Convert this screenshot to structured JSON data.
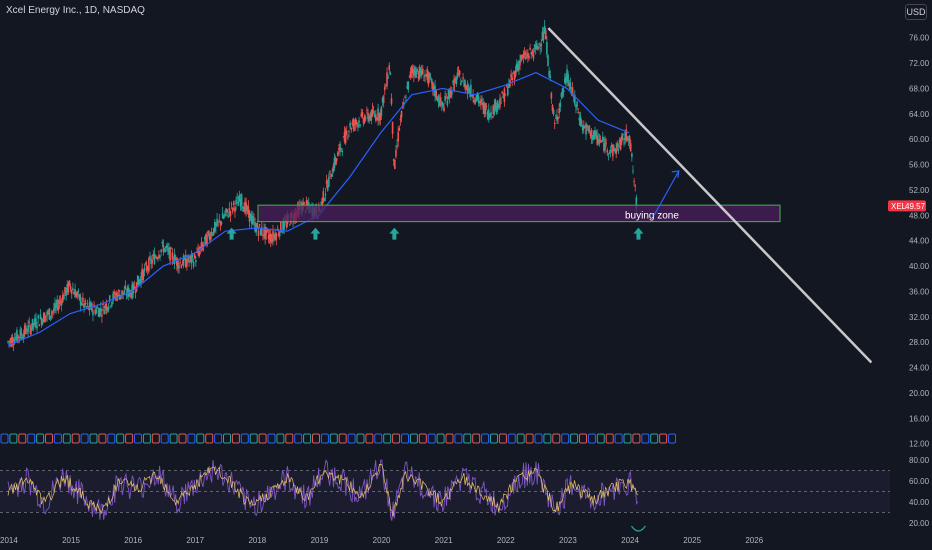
{
  "header": {
    "title": "Xcel Energy Inc., 1D, NASDAQ",
    "currency": "USD"
  },
  "colors": {
    "background": "#131722",
    "up": "#26a69a",
    "down": "#ef5350",
    "ma": "#2962ff",
    "zone_fill": "#4a1f5c",
    "zone_border": "#4caf50",
    "trendline": "#c8c8c8",
    "arrow": "#26a69a",
    "rsi": "#7e57c2",
    "rsi_signal": "#e9c46a",
    "price_tag": "#f23645"
  },
  "chart_data": [
    {
      "type": "line",
      "title": "Xcel Energy Inc., 1D, NASDAQ",
      "xlabel": "",
      "ylabel": "",
      "x_ticks": [
        "2014",
        "2015",
        "2016",
        "2017",
        "2018",
        "2019",
        "2020",
        "2021",
        "2022",
        "2023",
        "2024",
        "2025",
        "2026"
      ],
      "y_ticks": [
        "76.00",
        "72.00",
        "68.00",
        "64.00",
        "60.00",
        "56.00",
        "52.00",
        "48.00",
        "44.00",
        "40.00",
        "36.00",
        "32.00",
        "28.00",
        "24.00",
        "20.00",
        "16.00",
        "12.00"
      ],
      "ylim": [
        11,
        78
      ],
      "xlim": [
        2014.0,
        2028.2
      ],
      "series": [
        {
          "style": "candles",
          "x": [
            2014.0,
            2014.25,
            2014.5,
            2014.75,
            2015.0,
            2015.25,
            2015.5,
            2015.75,
            2016.0,
            2016.25,
            2016.5,
            2016.75,
            2017.0,
            2017.25,
            2017.5,
            2017.75,
            2018.0,
            2018.25,
            2018.5,
            2018.75,
            2019.0,
            2019.25,
            2019.5,
            2019.75,
            2020.0,
            2020.15,
            2020.22,
            2020.3,
            2020.5,
            2020.75,
            2021.0,
            2021.25,
            2021.5,
            2021.75,
            2022.0,
            2022.25,
            2022.5,
            2022.65,
            2022.8,
            2023.0,
            2023.25,
            2023.5,
            2023.75,
            2024.0,
            2024.12
          ],
          "values": [
            28.0,
            29.5,
            31.5,
            33.0,
            37.0,
            33.5,
            33.0,
            35.5,
            36.0,
            40.0,
            43.0,
            40.5,
            41.0,
            45.0,
            48.0,
            50.5,
            46.0,
            44.5,
            47.0,
            49.5,
            48.5,
            56.0,
            62.0,
            63.5,
            64.0,
            72.0,
            55.0,
            62.0,
            71.0,
            70.0,
            65.0,
            70.0,
            67.0,
            64.0,
            67.0,
            72.5,
            74.0,
            77.0,
            62.0,
            70.0,
            62.0,
            60.0,
            58.0,
            61.0,
            49.57
          ]
        },
        {
          "name": "MA",
          "style": "line",
          "x": [
            2014.0,
            2014.5,
            2015.0,
            2015.5,
            2016.0,
            2016.5,
            2017.0,
            2017.5,
            2018.0,
            2018.5,
            2019.0,
            2019.5,
            2020.0,
            2020.5,
            2021.0,
            2021.5,
            2022.0,
            2022.5,
            2023.0,
            2023.5,
            2024.0
          ],
          "values": [
            27.5,
            29.5,
            32.5,
            34.0,
            36.0,
            40.0,
            42.0,
            45.5,
            46.0,
            45.5,
            48.0,
            54.0,
            61.0,
            67.0,
            68.0,
            67.0,
            68.5,
            70.5,
            68.0,
            63.0,
            61.0
          ]
        }
      ],
      "annotations": {
        "buying_zone": {
          "label": "buying zone",
          "y_range": [
            47.0,
            49.6
          ]
        },
        "trendline": {
          "from": [
            2022.7,
            77.5
          ],
          "to": [
            2027.9,
            24.8
          ]
        },
        "last_price": {
          "symbol": "XEL",
          "value": "49.57"
        },
        "buy_arrows_x": [
          2017.6,
          2018.95,
          2020.22,
          2024.15
        ],
        "projection_arrow": {
          "from": [
            2024.4,
            48.0
          ],
          "to": [
            2024.8,
            55.0
          ]
        }
      }
    },
    {
      "type": "line",
      "title": "",
      "y_ticks": [
        "80.00",
        "60.00",
        "40.00",
        "20.00"
      ],
      "ylim": [
        15,
        85
      ],
      "bands": [
        30,
        50,
        70
      ],
      "series": [
        {
          "name": "RSI",
          "style": "line",
          "x": [
            2014.0,
            2014.3,
            2014.6,
            2014.9,
            2015.2,
            2015.5,
            2015.8,
            2016.1,
            2016.4,
            2016.7,
            2017.0,
            2017.3,
            2017.6,
            2017.9,
            2018.2,
            2018.5,
            2018.8,
            2019.1,
            2019.4,
            2019.7,
            2020.0,
            2020.2,
            2020.4,
            2020.7,
            2021.0,
            2021.3,
            2021.6,
            2021.9,
            2022.2,
            2022.5,
            2022.8,
            2023.1,
            2023.4,
            2023.7,
            2024.0,
            2024.15
          ],
          "values": [
            50,
            62,
            38,
            65,
            45,
            30,
            60,
            52,
            68,
            40,
            55,
            72,
            58,
            35,
            48,
            62,
            44,
            70,
            60,
            45,
            78,
            28,
            66,
            55,
            40,
            64,
            50,
            35,
            62,
            70,
            32,
            58,
            40,
            52,
            60,
            42
          ]
        }
      ]
    }
  ]
}
